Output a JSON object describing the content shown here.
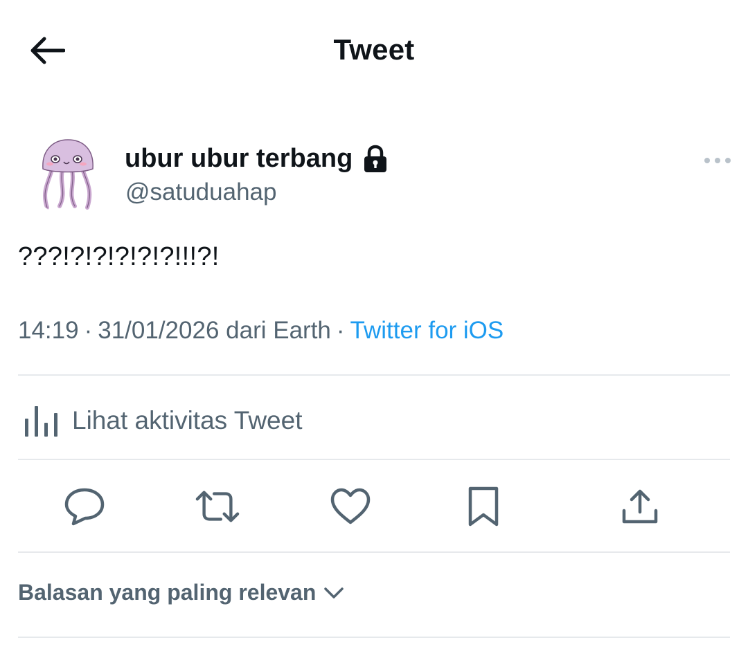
{
  "header": {
    "title": "Tweet",
    "back_icon": "arrow-left-icon"
  },
  "author": {
    "name": "ubur ubur terbang",
    "handle": "@satuduahap",
    "protected_icon": "lock-icon",
    "avatar": "jellyfish-avatar"
  },
  "tweet": {
    "text": "???!?!?!?!?!?!!!?!",
    "time": "14:19",
    "separator": "·",
    "date": "31/01/2026 dari Earth",
    "source": "Twitter for iOS"
  },
  "activity": {
    "label": "Lihat aktivitas Tweet",
    "icon": "analytics-bar-icon"
  },
  "actions": {
    "reply": "reply-icon",
    "retweet": "retweet-icon",
    "like": "heart-icon",
    "bookmark": "bookmark-icon",
    "share": "share-icon"
  },
  "replies": {
    "sort_label": "Balasan yang paling relevan"
  },
  "colors": {
    "text_primary": "#0f1419",
    "text_secondary": "#536471",
    "link": "#1d9bf0",
    "divider": "#e6e9ec"
  }
}
